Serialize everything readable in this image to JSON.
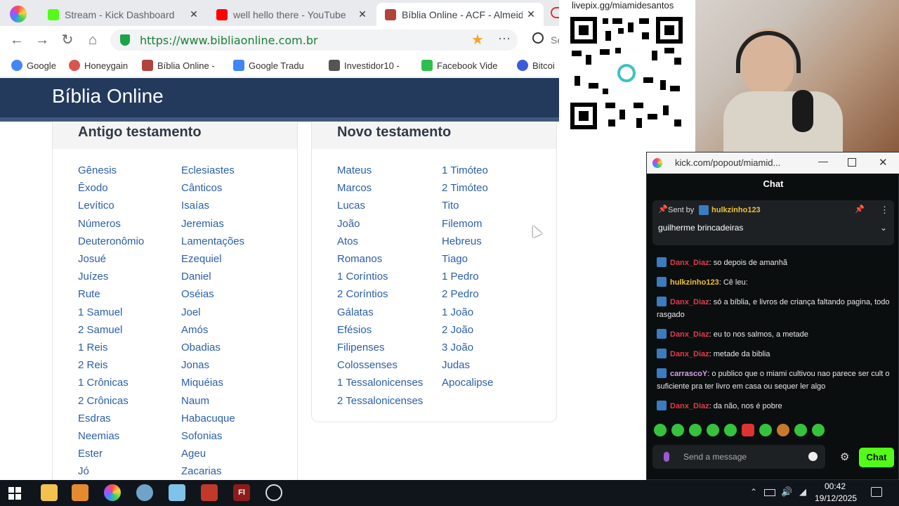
{
  "tabs": [
    {
      "title": "Stream - Kick Dashboard",
      "color": "#53fc18"
    },
    {
      "title": "well hello there - YouTube",
      "color": "#ff0000"
    },
    {
      "title": "Bíblia Online - ACF - Almeida",
      "color": "#b0433a"
    }
  ],
  "address": {
    "url": "https://www.bibliaonline.com.br",
    "search_label": "Se"
  },
  "bookmarks": [
    {
      "label": "Google",
      "color": "#4285f4"
    },
    {
      "label": "Honeygain",
      "color": "#d9534f"
    },
    {
      "label": "Bíblia Online -",
      "color": "#b0433a"
    },
    {
      "label": "Google Tradu",
      "color": "#4285f4"
    },
    {
      "label": "Investidor10 -",
      "color": "#555555"
    },
    {
      "label": "Facebook Vide",
      "color": "#2dbf4e"
    },
    {
      "label": "Bitcoi",
      "color": "#3b5bdb"
    }
  ],
  "site": {
    "title": "Bíblia Online"
  },
  "old_testament": {
    "heading": "Antigo testamento",
    "col1": [
      "Gênesis",
      "Êxodo",
      "Levítico",
      "Números",
      "Deuteronômio",
      "Josué",
      "Juízes",
      "Rute",
      "1 Samuel",
      "2 Samuel",
      "1 Reis",
      "2 Reis",
      "1 Crônicas",
      "2 Crônicas",
      "Esdras",
      "Neemias",
      "Ester",
      "Jó"
    ],
    "col2": [
      "Eclesiastes",
      "Cânticos",
      "Isaías",
      "Jeremias",
      "Lamentações",
      "Ezequiel",
      "Daniel",
      "Oséias",
      "Joel",
      "Amós",
      "Obadias",
      "Jonas",
      "Miquéias",
      "Naum",
      "Habacuque",
      "Sofonias",
      "Ageu",
      "Zacarias"
    ]
  },
  "new_testament": {
    "heading": "Novo testamento",
    "col1": [
      "Mateus",
      "Marcos",
      "Lucas",
      "João",
      "Atos",
      "Romanos",
      "1 Coríntios",
      "2 Coríntios",
      "Gálatas",
      "Efésios",
      "Filipenses",
      "Colossenses",
      "1 Tessalonicenses",
      "2 Tessalonicenses"
    ],
    "col2": [
      "1 Timóteo",
      "2 Timóteo",
      "Tito",
      "Filemom",
      "Hebreus",
      "Tiago",
      "1 Pedro",
      "2 Pedro",
      "1 João",
      "2 João",
      "3 João",
      "Judas",
      "Apocalipse"
    ]
  },
  "overlay": {
    "qr_label": "livepix.gg/miamidesantos"
  },
  "chat": {
    "window_title": "kick.com/popout/miamid...",
    "header": "Chat",
    "pinned": {
      "sent_by_label": "Sent by",
      "user": "hulkzinho123",
      "text": "guilherme brincadeiras"
    },
    "messages": [
      {
        "user": "Danx_Diaz",
        "color": "#e23b4a",
        "text": "so depois de amanhã"
      },
      {
        "user": "hulkzinho123",
        "color": "#f0c030",
        "text": "Cê leu:"
      },
      {
        "user": "Danx_Diaz",
        "color": "#e23b4a",
        "text": "só a bíblia, e livros de criança faltando pagina, todo rasgado"
      },
      {
        "user": "Danx_Diaz",
        "color": "#e23b4a",
        "text": "eu to nos salmos, a metade"
      },
      {
        "user": "Danx_Diaz",
        "color": "#e23b4a",
        "text": "metade da biblia"
      },
      {
        "user": "carrascoY",
        "color": "#d8a0e8",
        "text": "o publico que o miami cultivou nao parece ser cult o suficiente pra ter livro em casa ou sequer ler algo"
      },
      {
        "user": "Danx_Diaz",
        "color": "#e23b4a",
        "text": "da não, nos é pobre"
      }
    ],
    "input_placeholder": "Send a message",
    "send_label": "Chat"
  },
  "taskbar": {
    "time": "00:42",
    "date": "19/12/2025",
    "app_label": "Fl"
  }
}
